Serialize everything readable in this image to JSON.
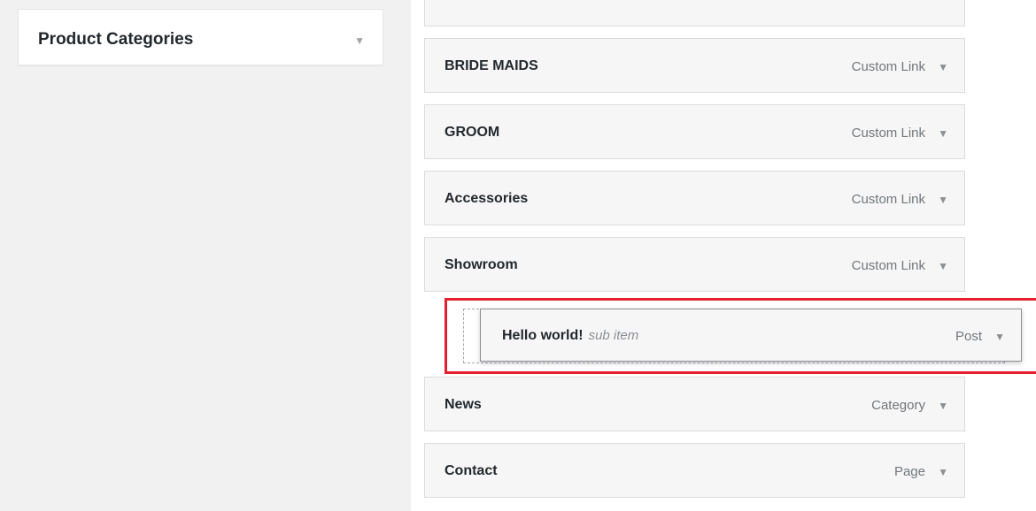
{
  "sidebar": {
    "product_categories": {
      "title": "Product Categories",
      "toggle_icon": "triangle-down-icon"
    }
  },
  "menu": {
    "items": [
      {
        "label": "BRIDE MAIDS",
        "type": "Custom Link"
      },
      {
        "label": "GROOM",
        "type": "Custom Link"
      },
      {
        "label": "Accessories",
        "type": "Custom Link"
      },
      {
        "label": "Showroom",
        "type": "Custom Link"
      },
      {
        "label": "News",
        "type": "Category"
      },
      {
        "label": "Contact",
        "type": "Page"
      }
    ],
    "dragging_item": {
      "label": "Hello world!",
      "sub_tag": "sub item",
      "type": "Post"
    },
    "arrow_glyph": "▼",
    "highlight_color": "#e3202f"
  }
}
